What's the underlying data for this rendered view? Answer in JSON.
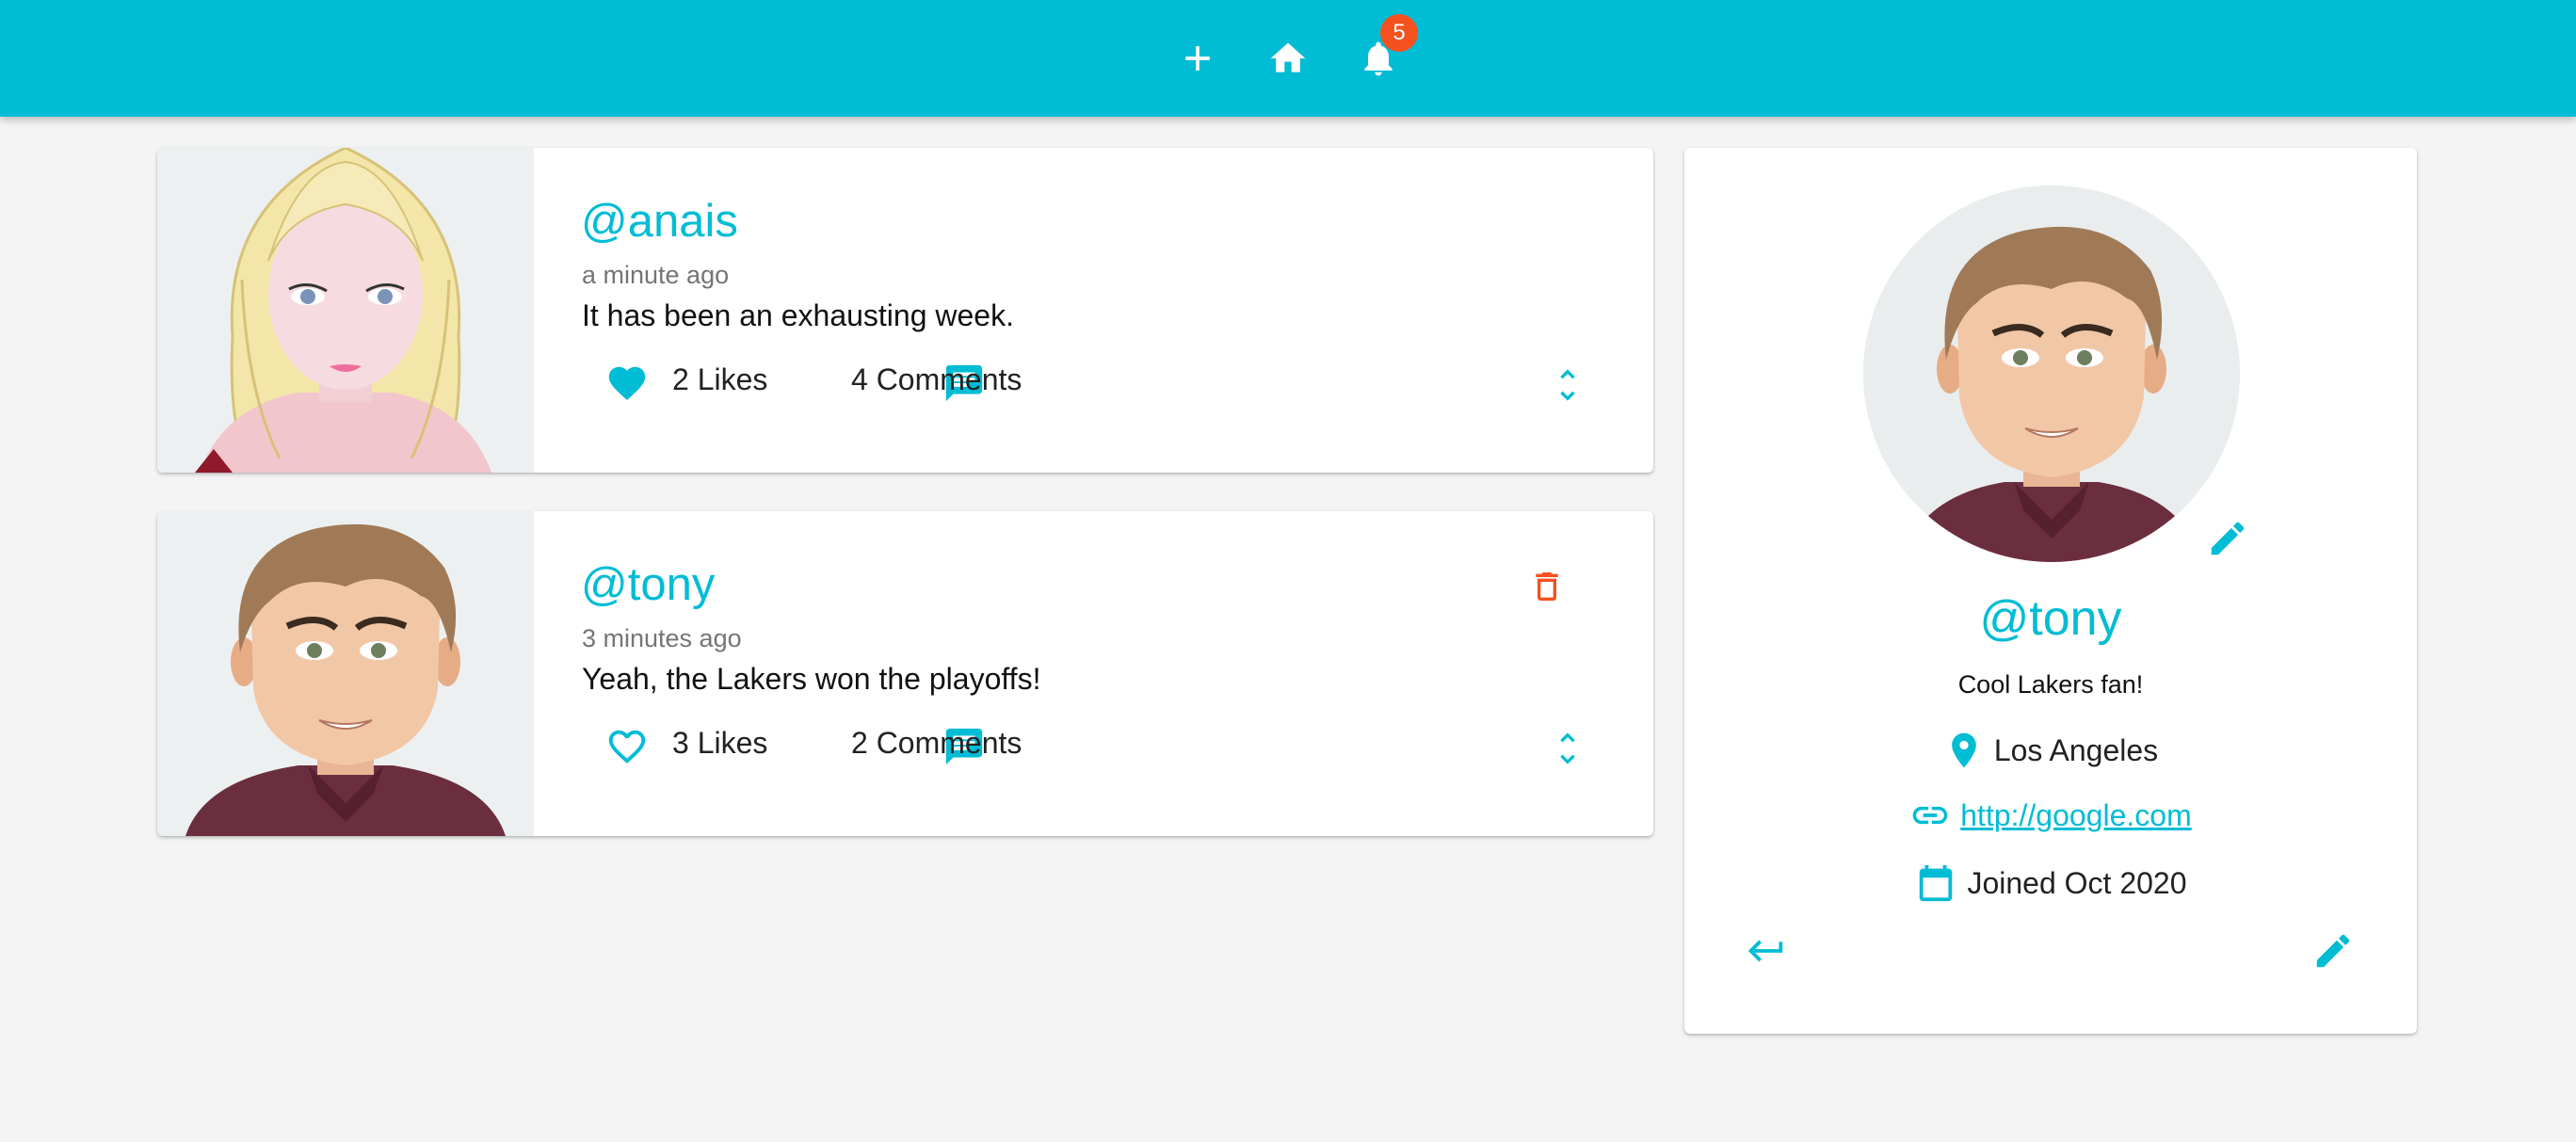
{
  "header": {
    "badge_count": "5",
    "icons": [
      "add-icon",
      "home-icon",
      "bell-icon"
    ],
    "accent_color": "#00bcd4"
  },
  "posts": [
    {
      "handle": "@anais",
      "time": "a minute ago",
      "body": "It has been an exhausting week.",
      "likes": "2 Likes",
      "comments": "4 Comments",
      "liked": true
    },
    {
      "handle": "@tony",
      "time": "3 minutes ago",
      "body": "Yeah, the Lakers won the playoffs!",
      "likes": "3 Likes",
      "comments": "2 Comments",
      "liked": false,
      "deletable": true
    }
  ],
  "profile": {
    "handle": "@tony",
    "bio": "Cool Lakers fan!",
    "location": "Los Angeles",
    "website": " http://google.com",
    "joined": "Joined Oct 2020"
  },
  "colors": {
    "accent": "#00bcd4",
    "danger": "#f4511e",
    "background": "#f4f4f4"
  }
}
